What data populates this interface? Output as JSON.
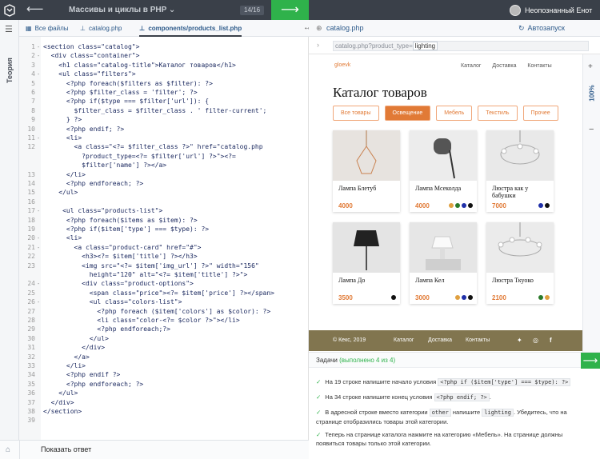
{
  "top": {
    "title": "Массивы и циклы в PHP",
    "progress": "14/16",
    "user": "Неопознанный Енот"
  },
  "left_strip": {
    "label": "Теория"
  },
  "editor_tabs": {
    "all_files": "Все файлы",
    "tab1": "catalog.php",
    "tab2": "components/products_list.php"
  },
  "code_lines": [
    {
      "n": "1",
      "fold": "-",
      "t": "<section class=\"catalog\">"
    },
    {
      "n": "2",
      "fold": "-",
      "t": "  <div class=\"container\">"
    },
    {
      "n": "3",
      "fold": "",
      "t": "    <h1 class=\"catalog-title\">Каталог товаров</h1>"
    },
    {
      "n": "4",
      "fold": "-",
      "t": "    <ul class=\"filters\">"
    },
    {
      "n": "5",
      "fold": "",
      "t": "      <?php foreach($filters as $filter): ?>"
    },
    {
      "n": "6",
      "fold": "",
      "t": "      <?php $filter_class = 'filter'; ?>"
    },
    {
      "n": "7",
      "fold": "",
      "t": "      <?php if($type === $filter['url']): {"
    },
    {
      "n": "8",
      "fold": "",
      "t": "        $filter_class = $filter_class . ' filter-current';"
    },
    {
      "n": "9",
      "fold": "",
      "t": "      } ?>"
    },
    {
      "n": "10",
      "fold": "",
      "t": "      <?php endif; ?>"
    },
    {
      "n": "11",
      "fold": "-",
      "t": "      <li>"
    },
    {
      "n": "12",
      "fold": "",
      "t": "        <a class=\"<?= $filter_class ?>\" href=\"catalog.php"
    },
    {
      "n": "",
      "fold": "",
      "t": "          ?product_type=<?= $filter['url'] ?>\"><?="
    },
    {
      "n": "",
      "fold": "",
      "t": "          $filter['name'] ?></a>"
    },
    {
      "n": "13",
      "fold": "",
      "t": "      </li>"
    },
    {
      "n": "14",
      "fold": "",
      "t": "      <?php endforeach; ?>"
    },
    {
      "n": "15",
      "fold": "",
      "t": "    </ul>"
    },
    {
      "n": "16",
      "fold": "",
      "t": ""
    },
    {
      "n": "17",
      "fold": "-",
      "t": "     <ul class=\"products-list\">"
    },
    {
      "n": "18",
      "fold": "",
      "t": "      <?php foreach($items as $item): ?>"
    },
    {
      "n": "19",
      "fold": "",
      "t": "      <?php if($item['type'] === $type): ?>"
    },
    {
      "n": "20",
      "fold": "-",
      "t": "      <li>"
    },
    {
      "n": "21",
      "fold": "-",
      "t": "        <a class=\"product-card\" href=\"#\">"
    },
    {
      "n": "22",
      "fold": "",
      "t": "          <h3><?= $item['title'] ?></h3>"
    },
    {
      "n": "23",
      "fold": "",
      "t": "          <img src=\"<?= $item['img_url'] ?>\" width=\"156\""
    },
    {
      "n": "",
      "fold": "",
      "t": "            height=\"120\" alt=\"<?= $item['title'] ?>\">"
    },
    {
      "n": "24",
      "fold": "-",
      "t": "          <div class=\"product-options\">"
    },
    {
      "n": "25",
      "fold": "",
      "t": "            <span class=\"price\"><?= $item['price'] ?></span>"
    },
    {
      "n": "26",
      "fold": "-",
      "t": "            <ul class=\"colors-list\">"
    },
    {
      "n": "27",
      "fold": "",
      "t": "              <?php foreach ($item['colors'] as $color): ?>"
    },
    {
      "n": "28",
      "fold": "",
      "t": "              <li class=\"color-<?= $color ?>\"></li>"
    },
    {
      "n": "29",
      "fold": "",
      "t": "              <?php endforeach;?>"
    },
    {
      "n": "30",
      "fold": "",
      "t": "            </ul>"
    },
    {
      "n": "31",
      "fold": "",
      "t": "          </div>"
    },
    {
      "n": "32",
      "fold": "",
      "t": "        </a>"
    },
    {
      "n": "33",
      "fold": "",
      "t": "      </li>"
    },
    {
      "n": "34",
      "fold": "",
      "t": "      <?php endif ?>"
    },
    {
      "n": "35",
      "fold": "",
      "t": "      <?php endforeach; ?>"
    },
    {
      "n": "36",
      "fold": "",
      "t": "    </ul>"
    },
    {
      "n": "37",
      "fold": "",
      "t": "  </div>"
    },
    {
      "n": "38",
      "fold": "",
      "t": "</section>"
    },
    {
      "n": "39",
      "fold": "",
      "t": ""
    }
  ],
  "bottom_left": {
    "show_answer": "Показать ответ"
  },
  "preview": {
    "tab": "catalog.php",
    "autorun": "Автозапуск",
    "url_prefix": "catalog.php?product_type=",
    "url_value": "lighting",
    "zoom": "100%",
    "site": {
      "logo": "gloevk",
      "nav": [
        "Каталог",
        "Доставка",
        "Контакты"
      ],
      "title": "Каталог товаров",
      "filters": [
        "Все товары",
        "Освещение",
        "Мебель",
        "Текстиль",
        "Прочее"
      ],
      "products": [
        {
          "name": "Лампа Блетуб",
          "price": "4000",
          "colors": []
        },
        {
          "name": "Лампа Мсеколда",
          "price": "4000",
          "colors": [
            "#e0a040",
            "#2a7a2a",
            "#1f2fa8",
            "#111111"
          ]
        },
        {
          "name": "Люстра как у бабушки",
          "price": "7000",
          "colors": [
            "#1f2fa8",
            "#111111"
          ]
        },
        {
          "name": "Лампа До",
          "price": "3500",
          "colors": [
            "#111111"
          ]
        },
        {
          "name": "Лампа Кел",
          "price": "3000",
          "colors": [
            "#e0a040",
            "#1f2fa8",
            "#111111"
          ]
        },
        {
          "name": "Люстра Ткуоко",
          "price": "2100",
          "colors": [
            "#2a7a2a",
            "#e0a040"
          ]
        }
      ],
      "footer": {
        "copyright": "© Кекс, 2019",
        "links": [
          "Каталог",
          "Доставка",
          "Контакты"
        ]
      }
    }
  },
  "tasks": {
    "header_prefix": "Задачи",
    "header_status": "(выполнено 4 из 4)",
    "items": [
      {
        "a": "На 19 строке напишите начало условия",
        "code": "<?php if ($item['type'] === $type): ?>",
        "b": ""
      },
      {
        "a": "На 34 строке напишите конец условия",
        "code": "<?php endif; ?>",
        "b": "."
      },
      {
        "a": "В адресной строке вместо категории",
        "code": "other",
        "b": "напишите",
        "code2": "lighting",
        "c": ". Убедитесь, что на странице отобразились товары этой категории."
      },
      {
        "a": "Теперь на странице каталога нажмите на категорию «Мебель». На странице должны появиться товары только этой категории.",
        "code": "",
        "b": ""
      }
    ]
  }
}
